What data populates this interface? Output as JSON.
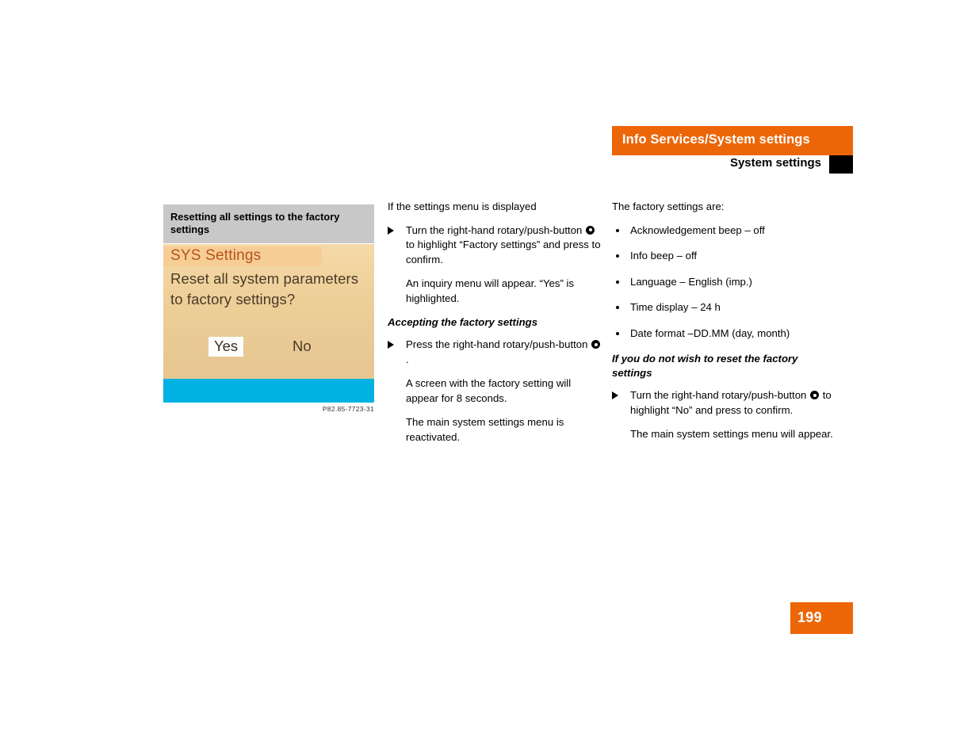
{
  "header": {
    "bar_title": "Info Services/System settings",
    "sub_title": "System settings"
  },
  "column_left": {
    "heading": "Resetting all settings to the factory settings",
    "figure": {
      "screen_title": "SYS Settings",
      "screen_body": "Reset all system parameters to factory settings?",
      "button_yes": "Yes",
      "button_no": "No",
      "highlighted_button": "Yes",
      "caption": "P82.85-7723-31",
      "colors": {
        "screen_background": "#eecf98",
        "title_band": "#f7cd96",
        "title_text": "#b4541a",
        "bottom_bar": "#00b2e3",
        "yes_highlight": "#fdfdfb"
      }
    }
  },
  "column_middle": {
    "intro": "If the settings menu  is displayed",
    "step1_part1": "Turn the right-hand rotary/push-button",
    "step1_part2": "to highlight “Factory settings” and press to confirm.",
    "step1_note": "An inquiry menu will appear. “Yes” is highlighted.",
    "subhead": "Accepting the factory settings",
    "step2_part1": "Press the right-hand rotary/push-button",
    "step2_part2": ".",
    "step2_note1": "A screen with the factory setting will appear for 8 seconds.",
    "step2_note2": "The main system settings menu is reactivated."
  },
  "column_right": {
    "intro": "The factory settings are:",
    "settings": [
      "Acknowledgement beep – off",
      "Info beep – off",
      "Language – English (imp.)",
      "Time display – 24 h",
      "Date format –DD.MM (day, month)"
    ],
    "subhead": "If you do not wish to reset the factory settings",
    "step1_part1": "Turn the right-hand rotary/push-button",
    "step1_part2": "to highlight “No” and press to confirm.",
    "step1_note": "The main system settings menu will appear."
  },
  "footer": {
    "page_number": "199"
  },
  "theme": {
    "accent_orange": "#ec6608",
    "heading_gray": "#c8c8c8",
    "tab_black": "#000000"
  }
}
